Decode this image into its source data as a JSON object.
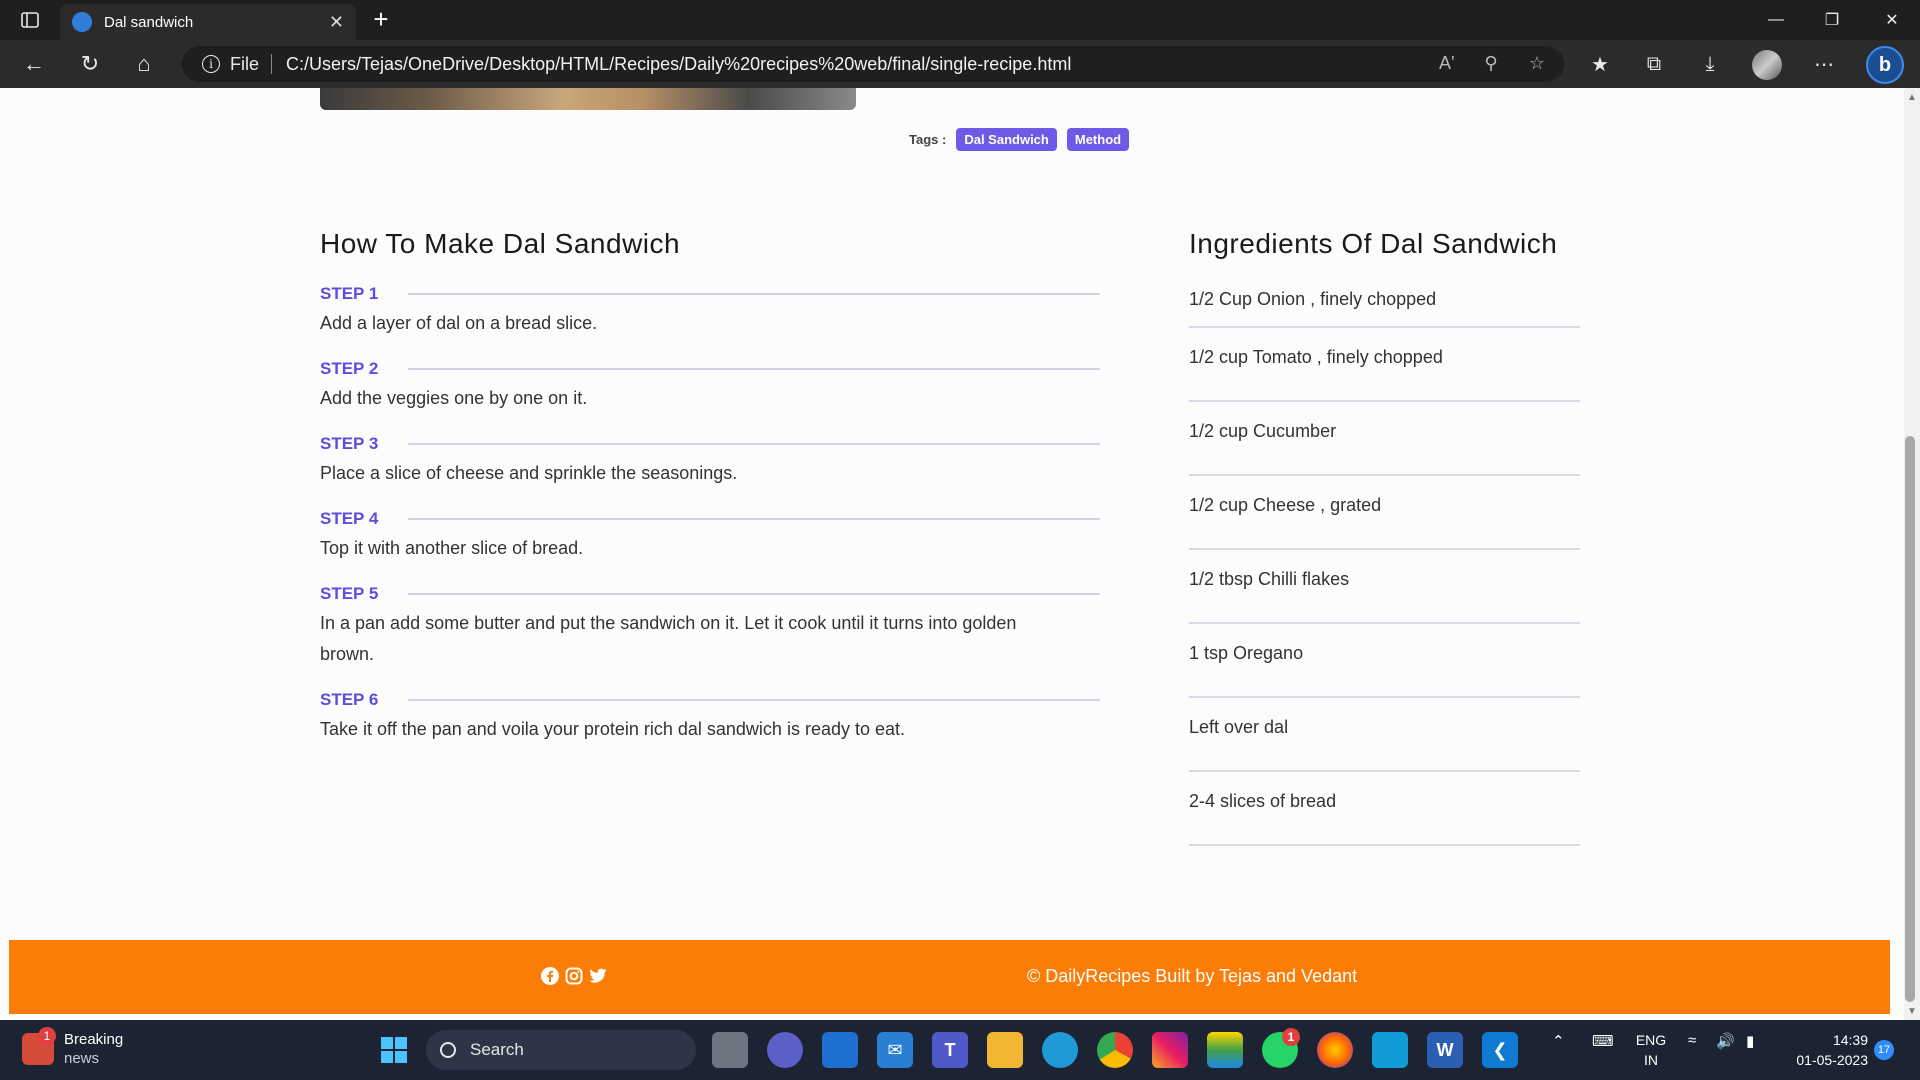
{
  "browser": {
    "tab_title": "Dal sandwich",
    "tab_close": "✕",
    "new_tab": "+",
    "address_prefix": "File",
    "url": "C:/Users/Tejas/OneDrive/Desktop/HTML/Recipes/Daily%20recipes%20web/final/single-recipe.html"
  },
  "page": {
    "tags_label": "Tags :",
    "tags": [
      "Dal Sandwich",
      "Method"
    ],
    "method_title": "How To Make Dal Sandwich",
    "steps": [
      {
        "label": "STEP 1",
        "text": "Add a layer of dal on a bread slice."
      },
      {
        "label": "STEP 2",
        "text": "Add the veggies one by one on it."
      },
      {
        "label": "STEP 3",
        "text": "Place a slice of cheese and sprinkle the seasonings."
      },
      {
        "label": "STEP 4",
        "text": "Top it with another slice of bread."
      },
      {
        "label": "STEP 5",
        "text": "In a pan add some butter and put the sandwich on it. Let it cook until it turns into golden brown."
      },
      {
        "label": "STEP 6",
        "text": "Take it off the pan and voila your protein rich dal sandwich is ready to eat."
      }
    ],
    "ingredients_title": "Ingredients Of Dal Sandwich",
    "ingredients": [
      "1/2 Cup Onion , finely chopped",
      "1/2 cup Tomato , finely chopped",
      "1/2 cup Cucumber",
      "1/2 cup Cheese , grated",
      "1/2 tbsp Chilli flakes",
      "1 tsp Oregano",
      "Left over dal",
      "2-4 slices of bread"
    ],
    "footer_text": "© DailyRecipes Built by Tejas and Vedant",
    "social_icons": [
      "facebook-icon",
      "instagram-icon",
      "twitter-icon"
    ],
    "accent_color": "#6d5ae6",
    "footer_color": "#fb7d07"
  },
  "taskbar": {
    "news_title": "Breaking",
    "news_sub": "news",
    "news_badge": "1",
    "search_label": "Search",
    "whatsapp_badge": "1",
    "lang_top": "ENG",
    "lang_bottom": "IN",
    "time": "14:39",
    "date": "01-05-2023",
    "notification_count": "17"
  }
}
